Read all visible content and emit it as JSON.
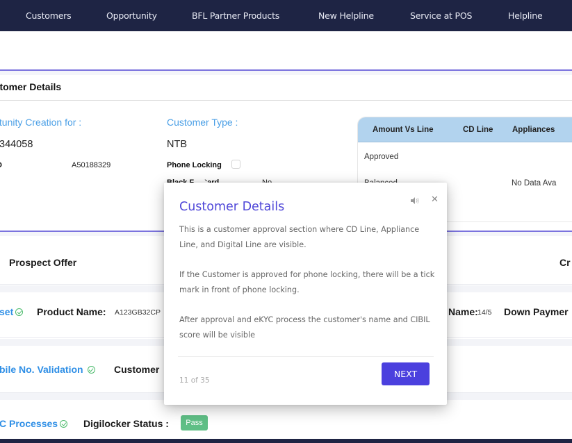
{
  "nav": {
    "items": [
      {
        "label": "Customers"
      },
      {
        "label": "Opportunity"
      },
      {
        "label": "BFL Partner Products"
      },
      {
        "label": "New Helpline"
      },
      {
        "label": "Service at POS"
      },
      {
        "label": "Helpline"
      }
    ]
  },
  "customer_details": {
    "title": "Customer Details",
    "opportunity_label": "Opportunity Creation for :",
    "opportunity_value": "344058",
    "id_label": "ID",
    "id_value": "A50188329",
    "customer_type_label": "Customer Type :",
    "customer_type_value": "NTB",
    "phone_locking_label": "Phone Locking",
    "phone_locking_checked": false,
    "black_card_label": "Black F... Card",
    "black_card_value": "No",
    "lines_table": {
      "headers": [
        "Amount Vs Line",
        "CD Line",
        "Appliances"
      ],
      "rows": [
        {
          "label": "Approved"
        },
        {
          "label": "Balanced"
        }
      ],
      "empty_text": "No Data Ava"
    }
  },
  "prospect_offer": {
    "title": "Prospect Offer",
    "right_title": "Cr"
  },
  "asset_row": {
    "asset_label": "set",
    "product_name_label": "Product Name:",
    "product_name_value": "A123GB32CP",
    "scheme_name_label": "Name:",
    "scheme_name_value": "14/5",
    "down_payment_label": "Down Paymer"
  },
  "mobile_row": {
    "validation_label": "bile No. Validation",
    "customer_label": "Customer"
  },
  "kyc_row": {
    "kyc_label": "C Processes",
    "digilocker_label": "Digilocker Status :",
    "digilocker_status": "Pass",
    "status_color": "#5fbf86"
  },
  "tour": {
    "title": "Customer Details",
    "paragraphs": [
      "This is a customer approval section where CD Line, Appliance Line, and Digital Line are visible.",
      "If the Customer is approved for phone locking, there will be a tick mark in front of phone locking.",
      "After approval and eKYC process the customer's name and CIBIL score will be visible"
    ],
    "counter": "11 of 35",
    "next_label": "NEXT",
    "close_glyph": "✕",
    "accent_color": "#4b40de"
  }
}
